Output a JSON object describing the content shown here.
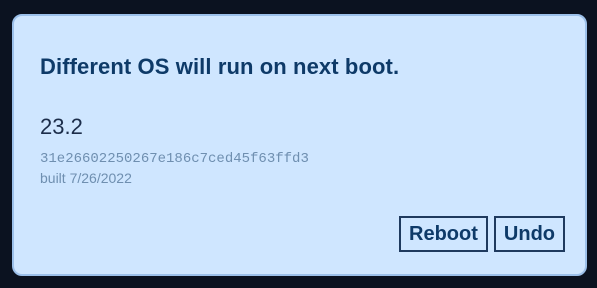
{
  "notification": {
    "title": "Different OS will run on next boot.",
    "version": "23.2",
    "commit_hash": "31e26602250267e186c7ced45f63ffd3",
    "built": "built 7/26/2022",
    "reboot_label": "Reboot",
    "undo_label": "Undo"
  },
  "colors": {
    "background": "#0b1220",
    "card": "#cfe6ff",
    "title": "#0e3a68",
    "muted_text": "#6f8fb0",
    "button_border": "#1f3a5e"
  }
}
